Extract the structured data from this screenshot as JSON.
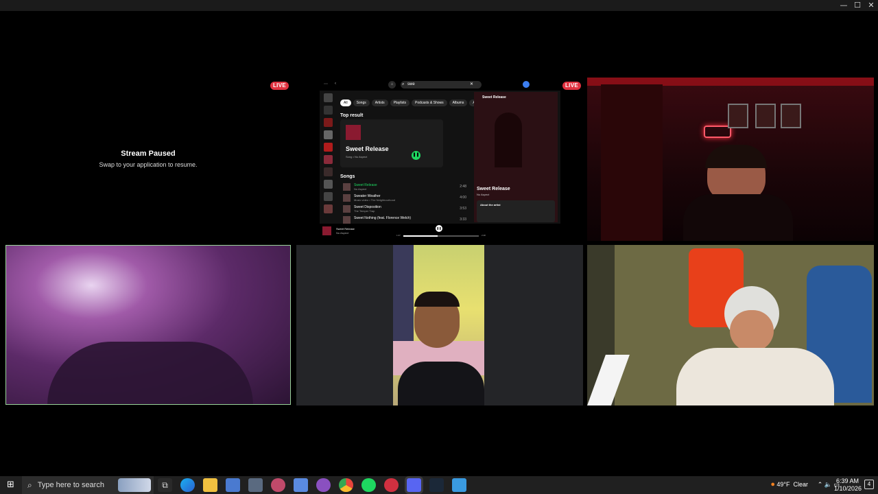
{
  "window": {
    "minimize": "—",
    "maximize": "☐",
    "close": "✕"
  },
  "paused_tile": {
    "title": "Stream Paused",
    "subtitle": "Swap to your application to resume.",
    "badge": "LIVE"
  },
  "spotify": {
    "badge": "LIVE",
    "search_value": "swe",
    "filters": [
      "All",
      "Songs",
      "Artists",
      "Playlists",
      "Podcasts & Shows",
      "Albums",
      "Audiobooks"
    ],
    "top_result_heading": "Top result",
    "top_result": {
      "title": "Sweet Release",
      "subtitle": "Song • Nu Aspect"
    },
    "songs_heading": "Songs",
    "songs": [
      {
        "title": "Sweet Release",
        "artist": "Nu Aspect",
        "duration": "2:48"
      },
      {
        "title": "Sweater Weather",
        "artist": "Music video • The Neighbourhood",
        "duration": "4:00"
      },
      {
        "title": "Sweet Disposition",
        "artist": "The Temper Trap",
        "duration": "3:53"
      },
      {
        "title": "Sweet Nothing (feat. Florence Welch)",
        "artist": "",
        "duration": "3:33"
      }
    ],
    "now_playing_panel": {
      "header": "Sweet Release",
      "title": "Sweet Release",
      "artist": "Nu Aspect",
      "about": "About the artist"
    },
    "player": {
      "title": "Sweet Release",
      "artist": "Nu Aspect",
      "elapsed": "1:27",
      "total": "2:48",
      "progress": 0.45
    }
  },
  "taskbar": {
    "search_placeholder": "Type here to search",
    "weather": "49°F  Clear",
    "time": "6:39 AM",
    "date": "1/10/2026",
    "notifications": "4",
    "apps": [
      "task-view",
      "edge",
      "file-explorer",
      "app-1",
      "calculator",
      "app-2",
      "app-3",
      "app-4",
      "chrome",
      "spotify",
      "app-5",
      "discord",
      "steam",
      "app-6"
    ]
  },
  "colors": {
    "live_badge": "#e03240",
    "spotify_green": "#1ed760",
    "active_speaker_border": "#9ad59a"
  }
}
